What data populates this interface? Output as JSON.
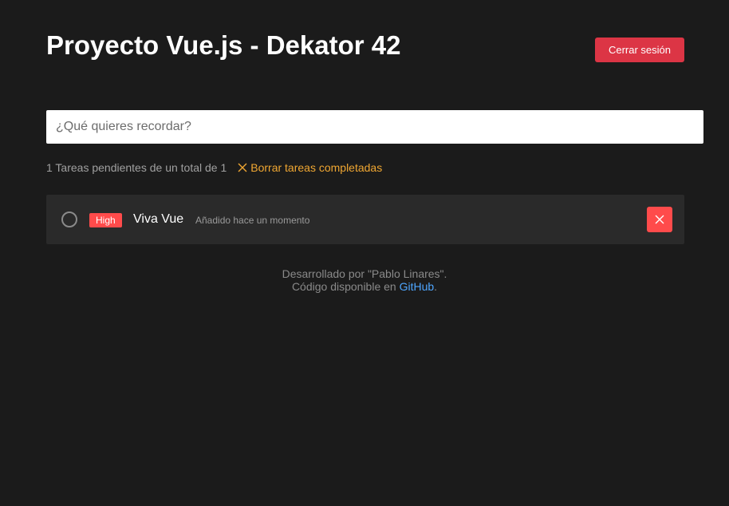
{
  "header": {
    "title": "Proyecto Vue.js - Dekator 42",
    "logout_label": "Cerrar sesión"
  },
  "new_task": {
    "placeholder": "¿Qué quieres recordar?",
    "value": ""
  },
  "summary": {
    "pending_text": "1 Tareas pendientes de un total de 1",
    "clear_completed_label": "Borrar tareas completadas"
  },
  "tasks": [
    {
      "priority": "High",
      "title": "Viva Vue",
      "time": "Añadido hace un momento",
      "completed": false
    }
  ],
  "footer": {
    "line1": "Desarrollado por \"Pablo Linares\".",
    "line2_prefix": "Código disponible en ",
    "link_label": "GitHub",
    "line2_suffix": "."
  },
  "colors": {
    "background": "#1b1b1b",
    "logout_button": "#dc3545",
    "priority_high": "#ff4b4b",
    "delete_button": "#ff4b4b",
    "clear_link": "#f0a732",
    "github_link": "#4ea6ff"
  },
  "icons": {
    "clear_completed": "close-icon",
    "delete_task": "close-icon",
    "task_status": "circle-outline-icon"
  }
}
